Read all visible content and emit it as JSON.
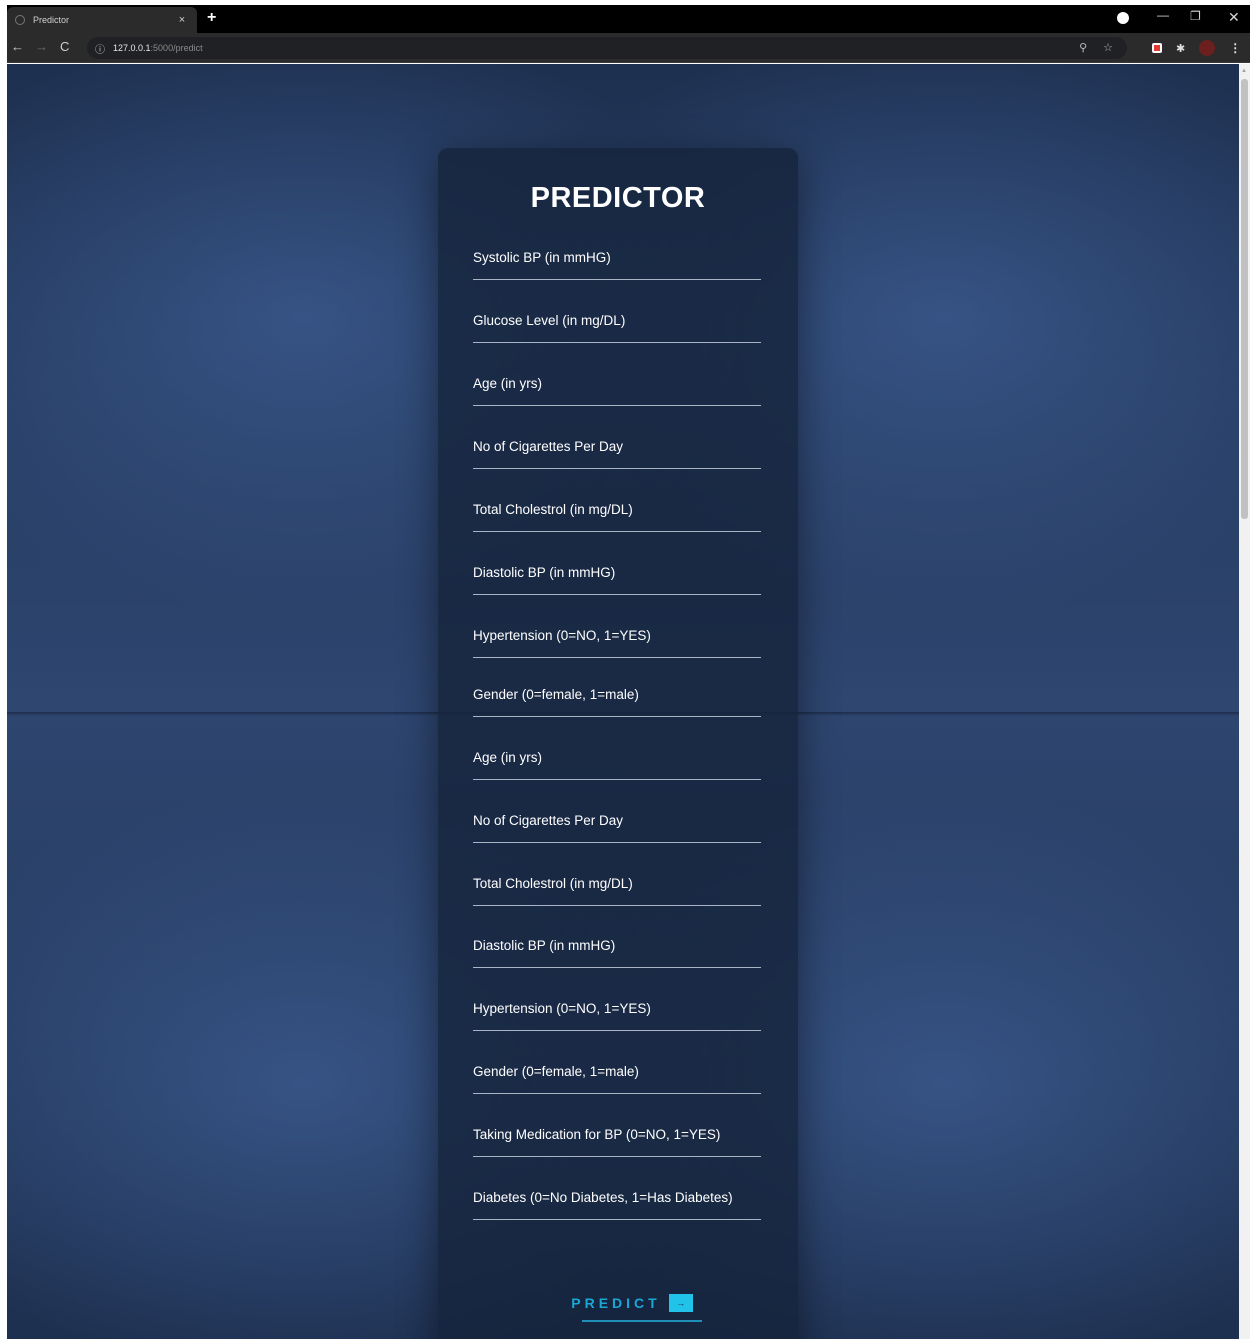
{
  "browser": {
    "tab_title": "Predictor",
    "tab_close": "×",
    "new_tab": "+",
    "url_host": "127.0.0.1",
    "url_path": ":5000/predict",
    "window_min": "—",
    "window_max": "❐",
    "window_close": "✕",
    "nav_back": "←",
    "nav_forward": "→",
    "nav_reload": "C",
    "info_icon": "ⓘ",
    "zoom_icon": "⚲",
    "star_icon": "☆",
    "puzzle_icon": "✱",
    "menu_icon": "⋮"
  },
  "card": {
    "title": "PREDICTOR",
    "fields": [
      "Systolic BP (in mmHG)",
      "Glucose Level (in mg/DL)",
      "Age (in yrs)",
      "No of Cigarettes Per Day",
      "Total Cholestrol (in mg/DL)",
      "Diastolic BP (in mmHG)",
      "Hypertension (0=NO, 1=YES)",
      "Gender (0=female, 1=male)",
      "Age (in yrs)",
      "No of Cigarettes Per Day",
      "Total Cholestrol (in mg/DL)",
      "Diastolic BP (in mmHG)",
      "Hypertension (0=NO, 1=YES)",
      "Gender (0=female, 1=male)",
      "Taking Medication for BP (0=NO, 1=YES)",
      "Diabetes (0=No Diabetes, 1=Has Diabetes)"
    ],
    "button_label": "PREDICT",
    "button_icon": "→"
  },
  "colors": {
    "accent": "#1aa7d6",
    "card_bg": "#14223a",
    "page_bg": "#2e4670"
  }
}
